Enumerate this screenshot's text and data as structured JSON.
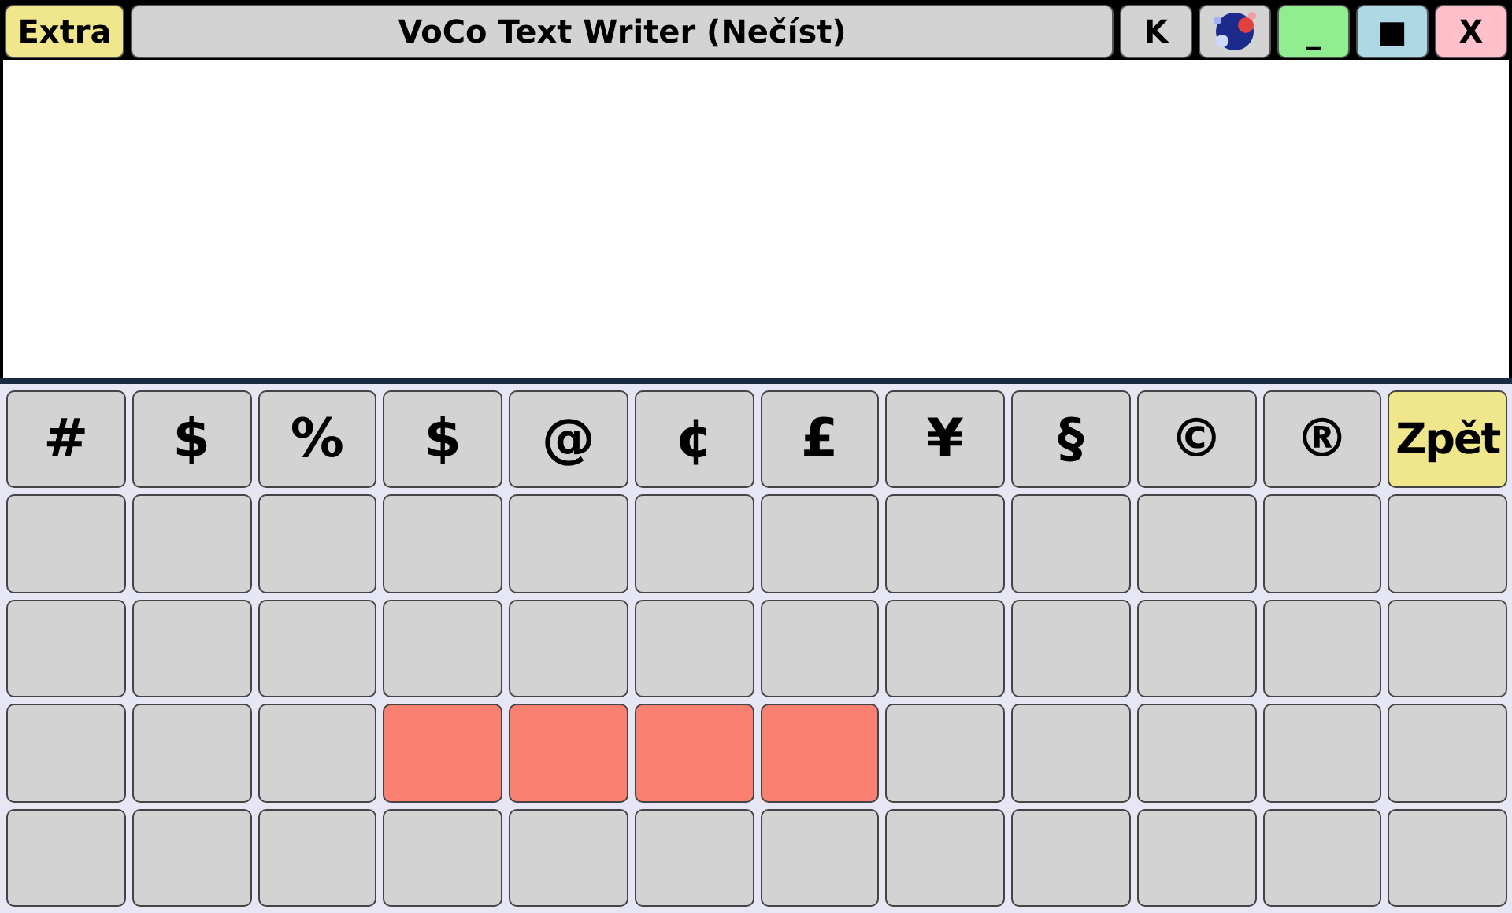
{
  "title_bar": {
    "extra_button": "Extra",
    "title": "VoCo Text Writer (Nečíst)",
    "k_button": "K",
    "minimize_button": "_",
    "maximize_button": "■",
    "close_button": "X"
  },
  "keyboard": {
    "rows": [
      [
        {
          "label": "#",
          "color": "#d3d3d3"
        },
        {
          "label": "$",
          "color": "#d3d3d3"
        },
        {
          "label": "%",
          "color": "#d3d3d3"
        },
        {
          "label": "$",
          "color": "#d3d3d3"
        },
        {
          "label": "@",
          "color": "#d3d3d3"
        },
        {
          "label": "¢",
          "color": "#d3d3d3"
        },
        {
          "label": "£",
          "color": "#d3d3d3"
        },
        {
          "label": "¥",
          "color": "#d3d3d3"
        },
        {
          "label": "§",
          "color": "#d3d3d3"
        },
        {
          "label": "©",
          "color": "#d3d3d3"
        },
        {
          "label": "®",
          "color": "#d3d3d3"
        },
        {
          "label": "Zpět",
          "color": "#f0e68c"
        }
      ],
      [
        {
          "color": "#d3d3d3"
        },
        {
          "color": "#d3d3d3"
        },
        {
          "color": "#d3d3d3"
        },
        {
          "color": "#d3d3d3"
        },
        {
          "color": "#d3d3d3"
        },
        {
          "color": "#d3d3d3"
        },
        {
          "color": "#d3d3d3"
        },
        {
          "color": "#d3d3d3"
        },
        {
          "color": "#d3d3d3"
        },
        {
          "color": "#d3d3d3"
        },
        {
          "color": "#d3d3d3"
        },
        {
          "color": "#d3d3d3"
        }
      ],
      [
        {
          "color": "#d3d3d3"
        },
        {
          "color": "#d3d3d3"
        },
        {
          "color": "#d3d3d3"
        },
        {
          "color": "#d3d3d3"
        },
        {
          "color": "#d3d3d3"
        },
        {
          "color": "#d3d3d3"
        },
        {
          "color": "#d3d3d3"
        },
        {
          "color": "#d3d3d3"
        },
        {
          "color": "#d3d3d3"
        },
        {
          "color": "#d3d3d3"
        },
        {
          "color": "#d3d3d3"
        },
        {
          "color": "#d3d3d3"
        }
      ],
      [
        {
          "color": "#d3d3d3"
        },
        {
          "color": "#d3d3d3"
        },
        {
          "color": "#d3d3d3"
        },
        {
          "color": "#fa8072"
        },
        {
          "color": "#fa8072"
        },
        {
          "color": "#fa8072"
        },
        {
          "color": "#fa8072"
        },
        {
          "color": "#d3d3d3"
        },
        {
          "color": "#d3d3d3"
        },
        {
          "color": "#d3d3d3"
        },
        {
          "color": "#d3d3d3"
        },
        {
          "color": "#d3d3d3"
        }
      ],
      [
        {
          "color": "#d3d3d3"
        },
        {
          "color": "#d3d3d3"
        },
        {
          "color": "#d3d3d3"
        },
        {
          "color": "#d3d3d3"
        },
        {
          "color": "#d3d3d3"
        },
        {
          "color": "#d3d3d3"
        },
        {
          "color": "#d3d3d3"
        },
        {
          "color": "#d3d3d3"
        },
        {
          "color": "#d3d3d3"
        },
        {
          "color": "#d3d3d3"
        },
        {
          "color": "#d3d3d3"
        },
        {
          "color": "#d3d3d3"
        }
      ]
    ]
  }
}
